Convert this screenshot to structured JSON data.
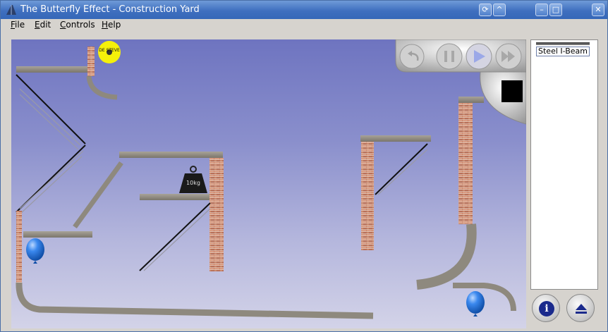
{
  "window": {
    "title": "The Butterfly Effect - Construction Yard",
    "controls": [
      "⟳",
      "^",
      "–",
      "□",
      "✕"
    ]
  },
  "menu": {
    "items": [
      {
        "label": "File",
        "underline": "F",
        "rest": "ile"
      },
      {
        "label": "Edit",
        "underline": "E",
        "rest": "dit"
      },
      {
        "label": "Controls",
        "underline": "C",
        "rest": "ontrols"
      },
      {
        "label": "Help",
        "underline": "H",
        "rest": "elp"
      }
    ]
  },
  "scene": {
    "weight_label": "10kg",
    "badge_label": "DE STEVE",
    "playback_buttons": [
      "undo",
      "pause",
      "play",
      "fast-forward"
    ]
  },
  "toolbox": {
    "items": [
      {
        "label": "Steel I-Beam"
      }
    ]
  },
  "bottom_buttons": [
    {
      "name": "info-button",
      "icon": "info-icon",
      "symbol": "i",
      "color": "#1a2a8c"
    },
    {
      "name": "eject-button",
      "icon": "eject-icon",
      "symbol": "⏏",
      "color": "#1a2a8c"
    }
  ]
}
